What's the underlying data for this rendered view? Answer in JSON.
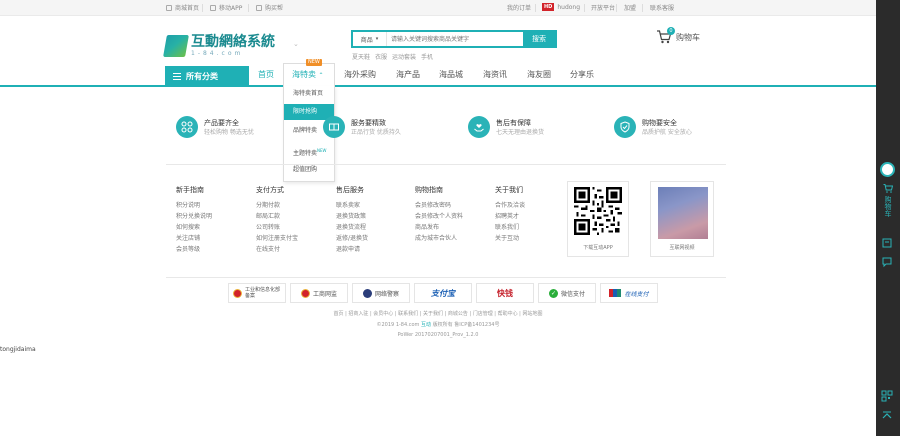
{
  "topbar": {
    "home": "商城首页",
    "app": "移动APP",
    "forum": "购买帮",
    "my_orders": "我的订单",
    "hudong_badge": "HD",
    "hudong": "hudong",
    "open_platform": "开放平台",
    "franchise": "加盟",
    "customer_service": "联系客服"
  },
  "logo": {
    "name": "互動網絡系統",
    "domain": "1-84.com"
  },
  "search": {
    "category": "商品",
    "placeholder": "请输入关键词搜索商品关键字",
    "button": "搜索",
    "hotwords": [
      "夏天鞋",
      "衣服",
      "运动套装",
      "手机"
    ]
  },
  "cart": {
    "label": "购物车",
    "count": "0"
  },
  "nav": {
    "category_button": "所有分类",
    "items": [
      "首页",
      "海外采购",
      "海产品",
      "海品城",
      "海资讯",
      "海友圈",
      "分享乐"
    ],
    "special": {
      "label": "海特卖",
      "badge": "NEW"
    },
    "dropdown": [
      {
        "label": "海特卖首页",
        "new": ""
      },
      {
        "label": "限时抢购",
        "new": ""
      },
      {
        "label": "品牌特卖",
        "new": ""
      },
      {
        "label": "主题特卖",
        "new": "NEW"
      },
      {
        "label": "超值团购",
        "new": ""
      }
    ]
  },
  "services": [
    {
      "title": "产品要齐全",
      "subtitle": "轻松购物 畅选无忧"
    },
    {
      "title": "服务要精致",
      "subtitle": "正品行货 优质持久"
    },
    {
      "title": "售后有保障",
      "subtitle": "七天无理由退换货"
    },
    {
      "title": "购物要安全",
      "subtitle": "品质护航 安全放心"
    }
  ],
  "footer_columns": [
    {
      "title": "新手指南",
      "links": [
        "积分说明",
        "积分兑换说明",
        "如何搜索",
        "关注店铺",
        "会员等级"
      ]
    },
    {
      "title": "支付方式",
      "links": [
        "分期付款",
        "邮局汇款",
        "公司转账",
        "如何注册支付宝",
        "在线支付"
      ]
    },
    {
      "title": "售后服务",
      "links": [
        "联系卖家",
        "退换货政策",
        "退换货流程",
        "返修/退换货",
        "退款申请"
      ]
    },
    {
      "title": "购物指南",
      "links": [
        "会员修改密码",
        "会员修改个人资料",
        "商品发布",
        "成为城市合伙人"
      ]
    },
    {
      "title": "关于我们",
      "links": [
        "合作及洽谈",
        "招聘英才",
        "联系我们",
        "关于互动"
      ]
    }
  ],
  "qr": {
    "label": "下载互动APP"
  },
  "ad": {
    "label": "互联网视频"
  },
  "badges": [
    "工业和信息化部备案",
    "工商网监",
    "网络警察",
    "支付宝",
    "快钱",
    "微信支付",
    "在线支付"
  ],
  "badge_icons": [
    "emblem-icon",
    "emblem-icon",
    "police-icon",
    "alipay-logo",
    "kuaiqian-logo",
    "wechat-pay-icon",
    "unionpay-logo"
  ],
  "footer_links": "首页 | 招商入驻 | 会员中心 | 联系我们 | 关于我们 | 商城公告 | 门店管理 | 帮助中心 | 网站地图",
  "copyright": "©2019 1-84.com",
  "copyright_company": "互动",
  "copyright_rest": "版权所有 鲁ICP备1401234号",
  "powered": "PoWer 20170207001_Prov_1.2.0",
  "debug_text": "tongjidaima",
  "right_toolbar": {
    "cart_label": "购物车"
  },
  "colors": {
    "accent": "#1fb0b5",
    "orange_badge": "#f08f28",
    "toolbar_bg": "#2b2b2b"
  }
}
